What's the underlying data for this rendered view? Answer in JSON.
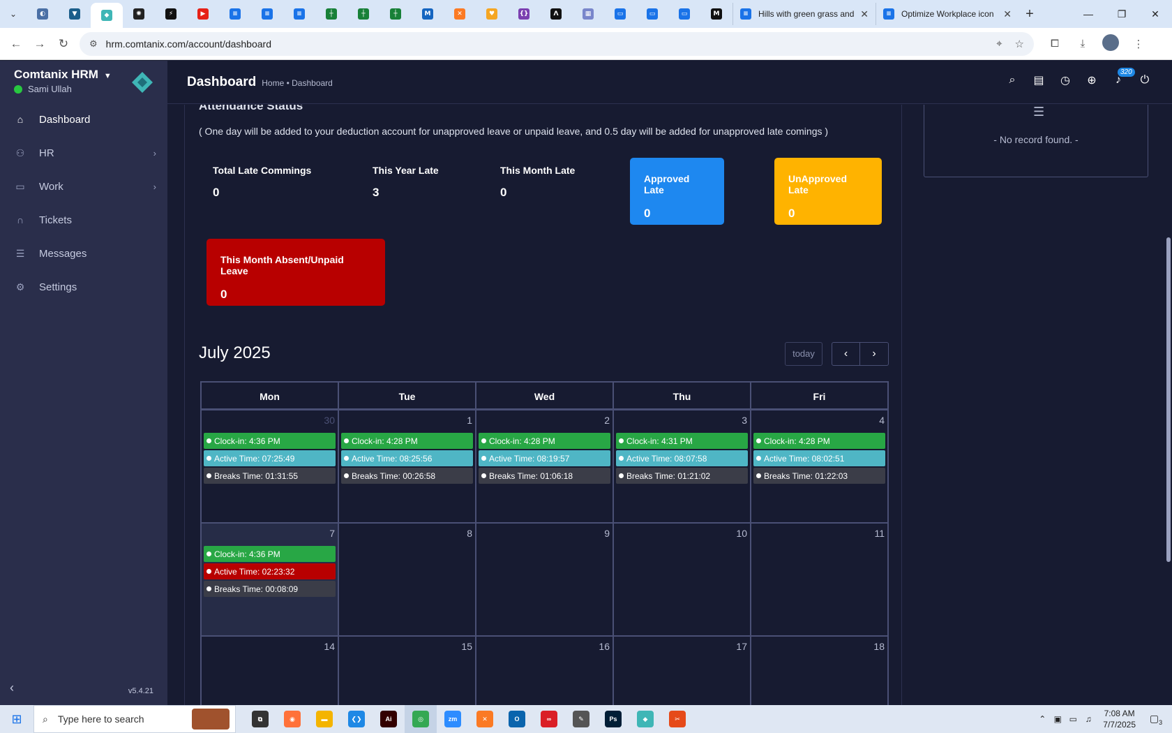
{
  "browser": {
    "pinned_tabs": [
      {
        "icon": "moon-icon",
        "color": "#4a6fa5",
        "glyph": "◐"
      },
      {
        "icon": "vpn-icon",
        "color": "#1b5e8a",
        "glyph": "▼"
      },
      {
        "icon": "comtanix-icon",
        "color": "#3fb6b6",
        "glyph": "◆",
        "active": true
      },
      {
        "icon": "openai-icon",
        "color": "#222222",
        "glyph": "✺"
      },
      {
        "icon": "bolt-icon",
        "color": "#111111",
        "glyph": "⚡"
      },
      {
        "icon": "youtube-icon",
        "color": "#e62117",
        "glyph": "▶"
      },
      {
        "icon": "docs-icon",
        "color": "#1a73e8",
        "glyph": "≡"
      },
      {
        "icon": "docs-icon",
        "color": "#1a73e8",
        "glyph": "≡"
      },
      {
        "icon": "docs-icon",
        "color": "#1a73e8",
        "glyph": "≡"
      },
      {
        "icon": "sheets-icon",
        "color": "#188038",
        "glyph": "┼"
      },
      {
        "icon": "sheets-icon",
        "color": "#188038",
        "glyph": "┼"
      },
      {
        "icon": "sheets-icon",
        "color": "#188038",
        "glyph": "┼"
      },
      {
        "icon": "analytics-icon",
        "color": "#1565c0",
        "glyph": "M"
      },
      {
        "icon": "xampp-icon",
        "color": "#fb7a24",
        "glyph": "✕"
      },
      {
        "icon": "fox-icon",
        "color": "#f5a623",
        "glyph": "♥"
      },
      {
        "icon": "regex-icon",
        "color": "#7b3fb0",
        "glyph": "{}"
      },
      {
        "icon": "code-icon",
        "color": "#111111",
        "glyph": "Λ"
      },
      {
        "icon": "grid-icon",
        "color": "#7986cb",
        "glyph": "▦"
      },
      {
        "icon": "forms-icon",
        "color": "#1a73e8",
        "glyph": "▭"
      },
      {
        "icon": "forms-icon",
        "color": "#1a73e8",
        "glyph": "▭"
      },
      {
        "icon": "forms-icon",
        "color": "#1a73e8",
        "glyph": "▭"
      },
      {
        "icon": "medium-icon",
        "color": "#111111",
        "glyph": "M"
      }
    ],
    "tabs": [
      {
        "title": "Hills with green grass and"
      },
      {
        "title": "Optimize Workplace icon"
      }
    ],
    "url": "hrm.comtanix.com/account/dashboard"
  },
  "sidebar": {
    "brand": "Comtanix HRM",
    "user": "Sami Ullah",
    "version": "v5.4.21",
    "items": [
      {
        "label": "Dashboard",
        "icon": "home-icon",
        "glyph": "⌂",
        "active": true,
        "chevron": false
      },
      {
        "label": "HR",
        "icon": "users-icon",
        "glyph": "⚇",
        "chevron": true
      },
      {
        "label": "Work",
        "icon": "briefcase-icon",
        "glyph": "▭",
        "chevron": true
      },
      {
        "label": "Tickets",
        "icon": "headset-icon",
        "glyph": "∩",
        "chevron": false
      },
      {
        "label": "Messages",
        "icon": "message-icon",
        "glyph": "☰",
        "chevron": false
      },
      {
        "label": "Settings",
        "icon": "gear-icon",
        "glyph": "⚙",
        "chevron": false
      }
    ]
  },
  "header": {
    "title": "Dashboard",
    "breadcrumb": "Home • Dashboard",
    "notification_count": "320"
  },
  "attendance": {
    "title": "Attendance Status",
    "note": "( One day will be added to your deduction account for unapproved leave or unpaid leave, and 0.5 day will be added for unapproved late comings )",
    "stats": [
      {
        "label": "Total Late Commings",
        "value": "0"
      },
      {
        "label": "This Year Late",
        "value": "3"
      },
      {
        "label": "This Month Late",
        "value": "0"
      }
    ],
    "cards": [
      {
        "label": "Approved Late",
        "value": "0",
        "color": "#1e88f0"
      },
      {
        "label": "UnApproved Late",
        "value": "0",
        "color": "#ffb300"
      },
      {
        "label": "This Month Absent/Unpaid Leave",
        "value": "0",
        "color": "#b80000"
      }
    ]
  },
  "calendar": {
    "month_title": "July 2025",
    "today_label": "today",
    "prev_glyph": "‹",
    "next_glyph": "›",
    "weekdays": [
      "Mon",
      "Tue",
      "Wed",
      "Thu",
      "Fri"
    ],
    "weeks": [
      [
        {
          "day": "30",
          "muted": true,
          "events": [
            {
              "type": "green",
              "text": "Clock-in: 4:36 PM"
            },
            {
              "type": "cyan",
              "text": "Active Time: 07:25:49"
            },
            {
              "type": "dark",
              "text": "Breaks Time: 01:31:55"
            }
          ]
        },
        {
          "day": "1",
          "events": [
            {
              "type": "green",
              "text": "Clock-in: 4:28 PM"
            },
            {
              "type": "cyan",
              "text": "Active Time: 08:25:56"
            },
            {
              "type": "dark",
              "text": "Breaks Time: 00:26:58"
            }
          ]
        },
        {
          "day": "2",
          "events": [
            {
              "type": "green",
              "text": "Clock-in: 4:28 PM"
            },
            {
              "type": "cyan",
              "text": "Active Time: 08:19:57"
            },
            {
              "type": "dark",
              "text": "Breaks Time: 01:06:18"
            }
          ]
        },
        {
          "day": "3",
          "events": [
            {
              "type": "green",
              "text": "Clock-in: 4:31 PM"
            },
            {
              "type": "cyan",
              "text": "Active Time: 08:07:58"
            },
            {
              "type": "dark",
              "text": "Breaks Time: 01:21:02"
            }
          ]
        },
        {
          "day": "4",
          "events": [
            {
              "type": "green",
              "text": "Clock-in: 4:28 PM"
            },
            {
              "type": "cyan",
              "text": "Active Time: 08:02:51"
            },
            {
              "type": "dark",
              "text": "Breaks Time: 01:22:03"
            }
          ]
        }
      ],
      [
        {
          "day": "7",
          "today": true,
          "events": [
            {
              "type": "green",
              "text": "Clock-in: 4:36 PM"
            },
            {
              "type": "red",
              "text": "Active Time: 02:23:32"
            },
            {
              "type": "dark",
              "text": "Breaks Time: 00:08:09"
            }
          ]
        },
        {
          "day": "8",
          "events": []
        },
        {
          "day": "9",
          "events": []
        },
        {
          "day": "10",
          "events": []
        },
        {
          "day": "11",
          "events": []
        }
      ],
      [
        {
          "day": "14",
          "events": []
        },
        {
          "day": "15",
          "events": []
        },
        {
          "day": "16",
          "events": []
        },
        {
          "day": "17",
          "events": []
        },
        {
          "day": "18",
          "events": []
        }
      ]
    ]
  },
  "right_panel": {
    "empty_text": "- No record found. -"
  },
  "taskbar": {
    "search_placeholder": "Type here to search",
    "apps": [
      {
        "icon": "task-view-icon",
        "color": "#333333",
        "glyph": "⧉"
      },
      {
        "icon": "firefox-icon",
        "color": "#ff7139",
        "glyph": "◉"
      },
      {
        "icon": "file-explorer-icon",
        "color": "#f4b400",
        "glyph": "▬"
      },
      {
        "icon": "vscode-icon",
        "color": "#1e88e5",
        "glyph": "❮❯"
      },
      {
        "icon": "illustrator-icon",
        "color": "#330000",
        "glyph": "Ai"
      },
      {
        "icon": "chrome-icon",
        "color": "#34a853",
        "glyph": "◎",
        "active": true
      },
      {
        "icon": "zoom-icon",
        "color": "#2d8cff",
        "glyph": "zm"
      },
      {
        "icon": "xampp-icon",
        "color": "#fb7a24",
        "glyph": "✕"
      },
      {
        "icon": "outlook-icon",
        "color": "#0a64ad",
        "glyph": "O"
      },
      {
        "icon": "creative-cloud-icon",
        "color": "#da1f26",
        "glyph": "∞"
      },
      {
        "icon": "pen-tool-icon",
        "color": "#555555",
        "glyph": "✎"
      },
      {
        "icon": "photoshop-icon",
        "color": "#001e36",
        "glyph": "Ps"
      },
      {
        "icon": "comtanix-icon",
        "color": "#3fb6b6",
        "glyph": "◆"
      },
      {
        "icon": "snipping-icon",
        "color": "#e64a19",
        "glyph": "✂"
      }
    ],
    "time": "7:08 AM",
    "date": "7/7/2025",
    "notification_count": "3"
  }
}
